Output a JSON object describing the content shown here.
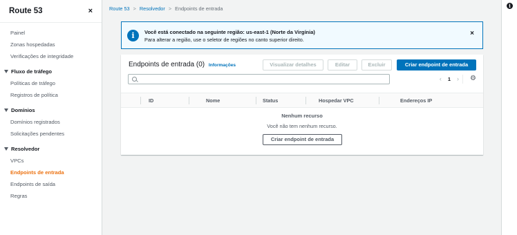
{
  "sidebar": {
    "title": "Route 53",
    "close_icon": "×",
    "items": [
      {
        "label": "Painel"
      },
      {
        "label": "Zonas hospedadas"
      },
      {
        "label": "Verificações de integridade"
      }
    ],
    "sections": [
      {
        "label": "Fluxo de tráfego",
        "items": [
          {
            "label": "Políticas de tráfego"
          },
          {
            "label": "Registros de política"
          }
        ]
      },
      {
        "label": "Domínios",
        "items": [
          {
            "label": "Domínios registrados"
          },
          {
            "label": "Solicitações pendentes"
          }
        ]
      },
      {
        "label": "Resolvedor",
        "items": [
          {
            "label": "VPCs"
          },
          {
            "label": "Endpoints de entrada",
            "active": true
          },
          {
            "label": "Endpoints de saída"
          },
          {
            "label": "Regras"
          }
        ]
      }
    ]
  },
  "breadcrumb": {
    "items": [
      "Route 53",
      "Resolvedor"
    ],
    "current": "Endpoints de entrada"
  },
  "alert": {
    "icon": "i",
    "title": "Você está conectado na seguinte região: us-east-1 (Norte da Virgínia)",
    "text": "Para alterar a região, use o seletor de regiões no canto superior direito.",
    "close_icon": "×"
  },
  "panel": {
    "title": "Endpoints de entrada",
    "count": "(0)",
    "info_link": "Informações",
    "buttons": {
      "view_details": "Visualizar detalhes",
      "edit": "Editar",
      "delete": "Excluir",
      "create": "Criar endpoint de entrada"
    },
    "search_placeholder": "",
    "pager": {
      "prev": "‹",
      "page": "1",
      "next": "›"
    },
    "gear_icon": "⚙",
    "columns": [
      "ID",
      "Nome",
      "Status",
      "Hospedar VPC",
      "Endereços IP"
    ],
    "empty": {
      "title": "Nenhum recurso",
      "text": "Você não tem nenhum recurso.",
      "button": "Criar endpoint de entrada"
    }
  },
  "right_rail": {
    "info_icon": "i"
  },
  "colors": {
    "accent": "#0073bb",
    "active_nav": "#ec7211",
    "alert_bg": "#f1faff"
  }
}
